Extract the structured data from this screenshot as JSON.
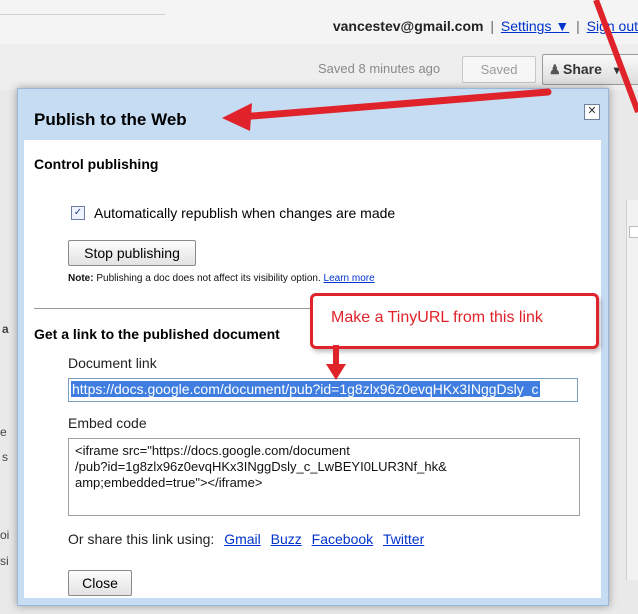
{
  "header": {
    "email": "vancestev@gmail.com",
    "separator": "|",
    "settings": "Settings ▼",
    "separator2": "|",
    "signout": "Sign out"
  },
  "toolbar": {
    "saved_status": "Saved 8 minutes ago",
    "saved_button": "Saved",
    "share_button": "Share",
    "share_caret": "▾"
  },
  "dialog": {
    "title": "Publish to the Web",
    "close_glyph": "✕",
    "control_heading": "Control publishing",
    "auto_republish": {
      "checked": true,
      "label": "Automatically republish when changes are made"
    },
    "stop_button": "Stop publishing",
    "note_bold": "Note:",
    "note_text": "Publishing a doc does not affect its visibility option.",
    "learn_more": "Learn more",
    "getlink_heading": "Get a link to the published document",
    "doc_link_label": "Document link",
    "doc_link_value": "https://docs.google.com/document/pub?id=1g8zlx96z0evqHKx3INggDsly_c",
    "embed_label": "Embed code",
    "embed_lines": [
      "<iframe src=\"https://docs.google.com/document",
      "/pub?id=1g8zlx96z0evqHKx3INggDsly_c_LwBEYI0LUR3Nf_hk&",
      "amp;embedded=true\"></iframe>"
    ],
    "share_label": "Or share this link using:",
    "share_links": [
      "Gmail",
      "Buzz",
      "Facebook",
      "Twitter"
    ],
    "close_button": "Close"
  },
  "annotation": {
    "callout_text": "Make a TinyURL from this link",
    "color": "#e0232a"
  },
  "background_fragments": {
    "frag_a": "a",
    "frag_e": "e",
    "frag_s": "s",
    "frag_oi": "oi",
    "frag_si": "si"
  }
}
